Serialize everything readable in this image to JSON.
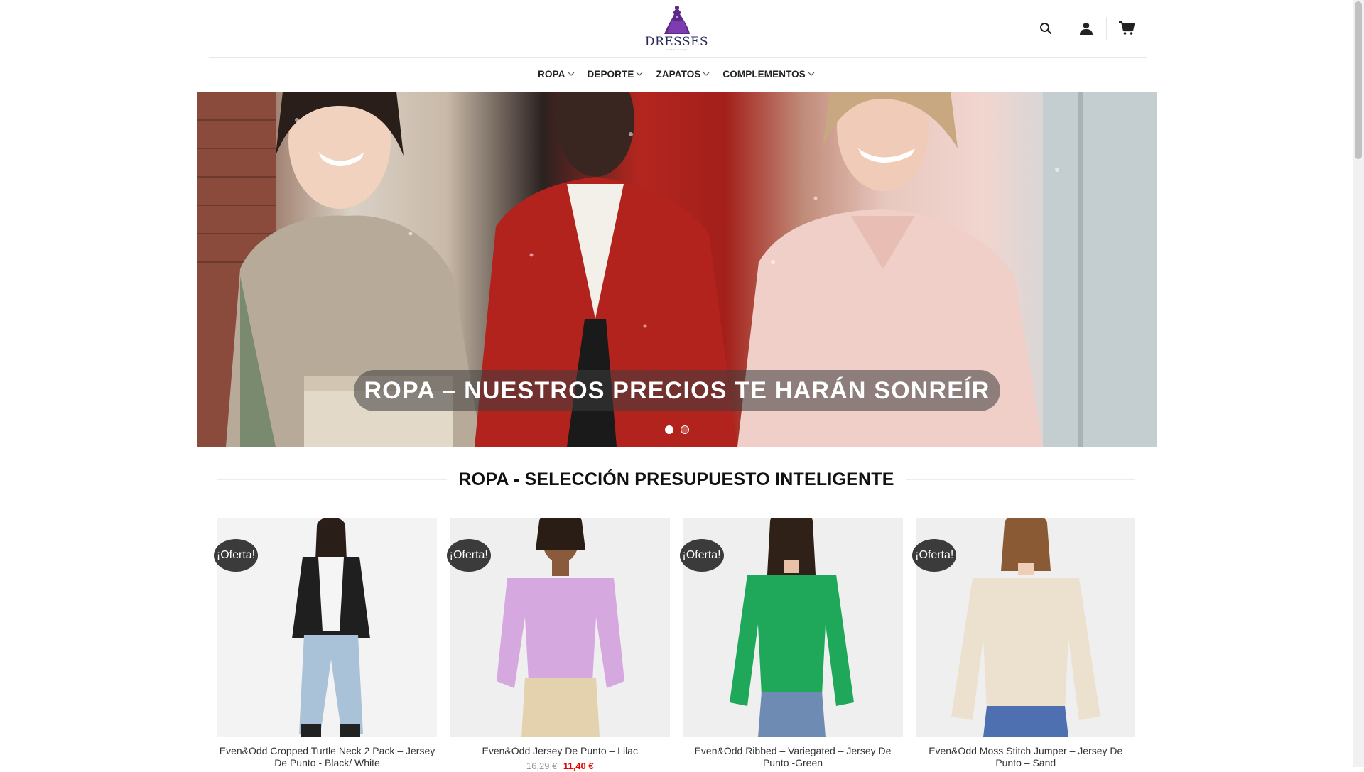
{
  "brand": {
    "name": "DRESSES",
    "tagline": "moda para mujer",
    "accent": "#5b2a86"
  },
  "header": {
    "icons": [
      "search-icon",
      "user-icon",
      "cart-icon"
    ]
  },
  "nav": {
    "items": [
      {
        "label": "ROPA"
      },
      {
        "label": "DEPORTE"
      },
      {
        "label": "ZAPATOS"
      },
      {
        "label": "COMPLEMENTOS"
      }
    ]
  },
  "hero": {
    "caption": "ROPA – NUESTROS PRECIOS TE HARÁN SONREÍR",
    "slides": 2,
    "active_slide": 1
  },
  "section": {
    "title": "ROPA - SELECCIÓN PRESUPUESTO INTELIGENTE"
  },
  "products": [
    {
      "badge": "¡Oferta!",
      "name": "Even&Odd Cropped Turtle Neck 2 Pack – Jersey De Punto - Black/ White",
      "old_price": "",
      "new_price": "",
      "garment_color": "#222222"
    },
    {
      "badge": "¡Oferta!",
      "name": "Even&Odd Jersey De Punto – Lilac",
      "old_price": "16,29 €",
      "new_price": "11,40 €",
      "garment_color": "#d6a8e0"
    },
    {
      "badge": "¡Oferta!",
      "name": "Even&Odd Ribbed – Variegated – Jersey De Punto -Green",
      "old_price": "",
      "new_price": "",
      "garment_color": "#1fa85a"
    },
    {
      "badge": "¡Oferta!",
      "name": "Even&Odd Moss Stitch Jumper – Jersey De Punto – Sand",
      "old_price": "",
      "new_price": "",
      "garment_color": "#ece1cf"
    }
  ],
  "colors": {
    "badge_bg": "#3b3b3b",
    "sale_price": "#ee0000"
  }
}
